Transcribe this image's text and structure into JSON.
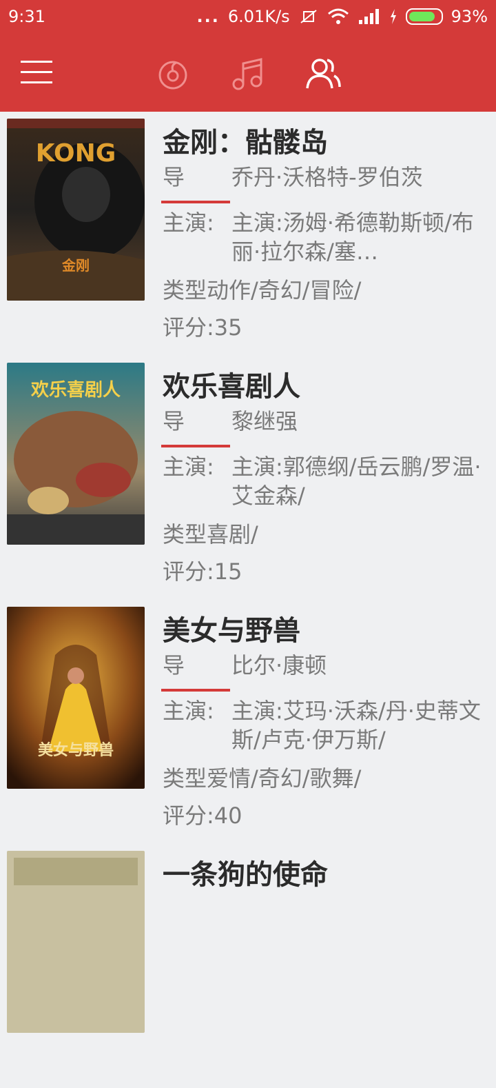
{
  "statusbar": {
    "time": "9:31",
    "dots": "...",
    "network_speed": "6.01K/s",
    "battery_percent": "93%",
    "battery_level": 0.93
  },
  "appbar": {
    "tabs": [
      {
        "icon": "music-disc-icon"
      },
      {
        "icon": "music-note-icon"
      },
      {
        "icon": "people-icon",
        "active": true
      }
    ]
  },
  "movies": [
    {
      "title": "金刚：骷髅岛",
      "director_label": "导",
      "director": "乔丹·沃格特-罗伯茨",
      "actors_label": "主演:",
      "actors": "主演:汤姆·希德勒斯顿/布丽·拉尔森/塞…",
      "genre": "类型动作/奇幻/冒险/",
      "score": "评分:35",
      "poster_text": "KONG",
      "poster_sub": "金刚"
    },
    {
      "title": "欢乐喜剧人",
      "director_label": "导",
      "director": "黎继强",
      "actors_label": "主演:",
      "actors": "主演:郭德纲/岳云鹏/罗温·艾金森/",
      "genre": "类型喜剧/",
      "score": "评分:15",
      "poster_text": "欢乐喜剧人",
      "poster_sub": ""
    },
    {
      "title": "美女与野兽",
      "director_label": "导",
      "director": "比尔·康顿",
      "actors_label": "主演:",
      "actors": "主演:艾玛·沃森/丹·史蒂文斯/卢克·伊万斯/",
      "genre": "类型爱情/奇幻/歌舞/",
      "score": "评分:40",
      "poster_text": "美女与野兽",
      "poster_sub": ""
    },
    {
      "title": "一条狗的使命",
      "director_label": "",
      "director": "",
      "actors_label": "",
      "actors": "",
      "genre": "",
      "score": "",
      "poster_text": "",
      "poster_sub": ""
    }
  ]
}
